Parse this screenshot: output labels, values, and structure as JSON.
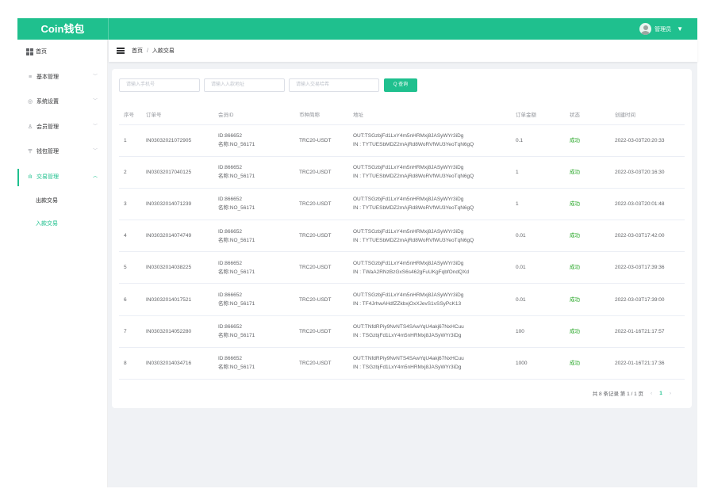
{
  "app": {
    "logo": "Coin钱包"
  },
  "header": {
    "username": "管理员",
    "caret": "▼"
  },
  "sidebar": {
    "items": [
      {
        "label": "首页",
        "icon": "dashboard-icon",
        "glyph": ""
      },
      {
        "label": "基本管理",
        "icon": "menu-lines-icon",
        "glyph": "≡"
      },
      {
        "label": "系统设置",
        "icon": "gear-icon",
        "glyph": "◎"
      },
      {
        "label": "会员管理",
        "icon": "user-icon",
        "glyph": "♙"
      },
      {
        "label": "钱包管理",
        "icon": "wallet-icon",
        "glyph": "〒"
      },
      {
        "label": "交易管理",
        "icon": "chart-icon",
        "glyph": "ılı"
      }
    ],
    "sub_items": [
      {
        "label": "出款交易"
      },
      {
        "label": "入款交易"
      }
    ]
  },
  "breadcrumb": {
    "home": "首页",
    "sep": "/",
    "current": "入款交易"
  },
  "filters": {
    "phone_placeholder": "请输入手机号",
    "address_placeholder": "请输入入款地址",
    "hash_placeholder": "请输入交易哈希",
    "search_label": "Q 查询"
  },
  "table": {
    "headers": [
      "序号",
      "订单号",
      "会员ID",
      "币种简称",
      "地址",
      "订单金额",
      "状态",
      "创建时间"
    ],
    "rows": [
      {
        "seq": "1",
        "order": "IN03032021072905",
        "member_id": "ID:866652",
        "member_name": "名称:NO_56171",
        "coin": "TRC20-USDT",
        "out": "OUT:TSGzbjFd1LxY4m5nHRMxj8JASyWYr3iDg",
        "in": "IN : TYTUESbMDZ2mAjRd8WoRVfWU3YeoTqN6gQ",
        "amount": "0.1",
        "status": "成功",
        "time": "2022-03-03T20:20:33"
      },
      {
        "seq": "2",
        "order": "IN03032017040125",
        "member_id": "ID:866652",
        "member_name": "名称:NO_56171",
        "coin": "TRC20-USDT",
        "out": "OUT:TSGzbjFd1LxY4m5nHRMxj8JASyWYr3iDg",
        "in": "IN : TYTUESbMDZ2mAjRd8WoRVfWU3YeoTqN6gQ",
        "amount": "1",
        "status": "成功",
        "time": "2022-03-03T20:16:30"
      },
      {
        "seq": "3",
        "order": "IN03032014071239",
        "member_id": "ID:866652",
        "member_name": "名称:NO_56171",
        "coin": "TRC20-USDT",
        "out": "OUT:TSGzbjFd1LxY4m5nHRMxj8JASyWYr3iDg",
        "in": "IN : TYTUESbMDZ2mAjRd8WoRVfWU3YeoTqN6gQ",
        "amount": "1",
        "status": "成功",
        "time": "2022-03-03T20:01:48"
      },
      {
        "seq": "4",
        "order": "IN03032014074749",
        "member_id": "ID:866652",
        "member_name": "名称:NO_56171",
        "coin": "TRC20-USDT",
        "out": "OUT:TSGzbjFd1LxY4m5nHRMxj8JASyWYr3iDg",
        "in": "IN : TYTUESbMDZ2mAjRd8WoRVfWU3YeoTqN6gQ",
        "amount": "0.01",
        "status": "成功",
        "time": "2022-03-03T17:42:00"
      },
      {
        "seq": "5",
        "order": "IN03032014038225",
        "member_id": "ID:866652",
        "member_name": "名称:NO_56171",
        "coin": "TRC20-USDT",
        "out": "OUT:TSGzbjFd1LxY4m5nHRMxj8JASyWYr3iDg",
        "in": "IN : TWaA2RNzBzGxS6s462gFuUKgFqbfOndQXd",
        "amount": "0.01",
        "status": "成功",
        "time": "2022-03-03T17:39:36"
      },
      {
        "seq": "6",
        "order": "IN03032014017521",
        "member_id": "ID:866652",
        "member_name": "名称:NO_56171",
        "coin": "TRC20-USDT",
        "out": "OUT:TSGzbjFd1LxY4m5nHRMxj8JASyWYr3iDg",
        "in": "IN : TF4JrhwAHdfZZkbxjOxXJevS1vSSyPcK13",
        "amount": "0.01",
        "status": "成功",
        "time": "2022-03-03T17:39:00"
      },
      {
        "seq": "7",
        "order": "IN03032014052280",
        "member_id": "ID:866652",
        "member_name": "名称:NO_56171",
        "coin": "TRC20-USDT",
        "out": "OUT:TNfdRPiy9NvNTS4SAwYqU4akj67NxHCuu",
        "in": "IN : TSGzbjFd1LxY4m5nHRMxj8JASyWYr3iDg",
        "amount": "100",
        "status": "成功",
        "time": "2022-01-16T21:17:57"
      },
      {
        "seq": "8",
        "order": "IN03032014034716",
        "member_id": "ID:866652",
        "member_name": "名称:NO_56171",
        "coin": "TRC20-USDT",
        "out": "OUT:TNfdRPiy9NvNTS4SAwYqU4akj67NxHCuu",
        "in": "IN : TSGzbjFd1LxY4m5nHRMxj8JASyWYr3iDg",
        "amount": "1000",
        "status": "成功",
        "time": "2022-01-16T21:17:36"
      }
    ]
  },
  "pagination": {
    "summary": "共 8 条记录 第 1 / 1 页",
    "prev": "‹",
    "next": "›",
    "current_page": "1"
  },
  "colors": {
    "brand": "#1fc08e",
    "success": "#1fa31f",
    "background": "#f0f2f5"
  }
}
